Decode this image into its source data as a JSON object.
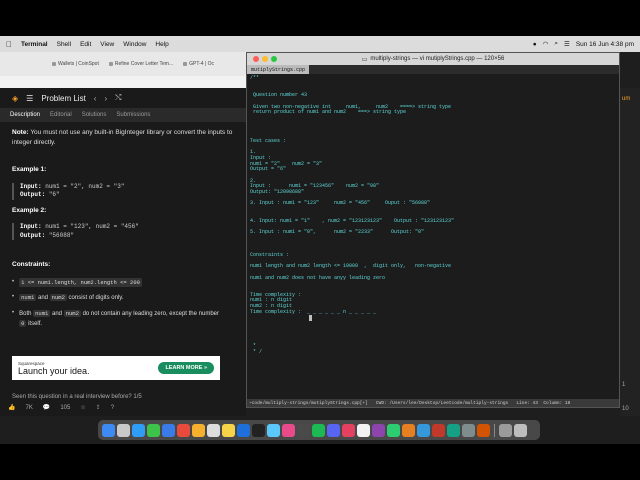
{
  "menubar": {
    "app": "Terminal",
    "items": [
      "Shell",
      "Edit",
      "View",
      "Window",
      "Help"
    ],
    "clock": "Sun 16 Jun  4:38 pm"
  },
  "browser": {
    "tabs": [
      "Wallets | CoinSpot",
      "Refine Cover Letter Tem...",
      "GPT-4 | Oc"
    ]
  },
  "leetcode": {
    "topbar_title": "Problem List",
    "tabs": [
      "Description",
      "Editorial",
      "Solutions",
      "Submissions"
    ],
    "note_bold": "Note:",
    "note_text": "You must not use any built-in BigInteger library or convert the inputs to integer directly.",
    "example1_title": "Example 1:",
    "example1_input_label": "Input:",
    "example1_input": "num1 = \"2\", num2 = \"3\"",
    "example1_output_label": "Output:",
    "example1_output": "\"6\"",
    "example2_title": "Example 2:",
    "example2_input_label": "Input:",
    "example2_input": "num1 = \"123\", num2 = \"456\"",
    "example2_output_label": "Output:",
    "example2_output": "\"56088\"",
    "constraints_title": "Constraints:",
    "c1_code": "1 <= num1.length, num2.length <= 200",
    "c2_code_a": "num1",
    "c2_mid": "and",
    "c2_code_b": "num2",
    "c2_end": "consist of digits only.",
    "c3_start": "Both",
    "c3_code_a": "num1",
    "c3_mid": "and",
    "c3_code_b": "num2",
    "c3_end": "do not contain any leading zero, except the number",
    "c3_code_c": "0",
    "c3_tail": "itself.",
    "ad_brand": "Squarespace",
    "ad_tagline": "Launch your idea.",
    "ad_button": "LEARN MORE  »",
    "seen_question": "Seen this question in a real interview before?    1/5",
    "likes": "7K",
    "comments": "105"
  },
  "right_strip": {
    "top_text": "um",
    "n1": "1",
    "n2": "10"
  },
  "terminal": {
    "title": "multiply-strings — vi mutiplyStrings.cpp — 120×56",
    "file_tab": "mutiplyStrings.cpp",
    "lines": [
      "/**",
      "",
      "",
      " Question number 43",
      "",
      " Given two non-negative int     num1,     num2    ====> string type",
      " return product of num1 and num2    ===> string type",
      "",
      "",
      "",
      "",
      "Test cases :",
      "",
      "1.",
      "Input :",
      "num1 = \"2\"    num2 = \"3\"",
      "Output = \"6\"",
      "",
      "2.",
      "Input :      num1 = \"123456\"    num2 = \"98\"",
      "Output: \"12098688\"",
      "",
      "3. Input : num1 = \"123\"     num2 = \"456\"     Ouput : \"56088\"",
      "",
      "",
      "4. Input: num1 = \"1\"    , num2 = \"123123123\"    Output : \"123123123\"",
      "",
      "5. Input : num1 = \"0\",      num2 = \"2233\"      Output: \"0\"",
      "",
      "",
      "",
      "Constraints :",
      "",
      "num1 length and num2 length <= 10000  ,  digit only,   non-negative",
      "",
      "num1 and num2 does not have anyy leading zero",
      "",
      "",
      "Time complexity :",
      "num1 : n digit",
      "num2 : n digit",
      "Time complexity :  _ _ _ _ _ _ n _ _ _ _ _",
      "",
      "",
      "",
      "",
      "",
      " *",
      " * /"
    ],
    "status": "~code/multiply-strings/mutiplyStrings.cpp[+]   CWD: /Users/lee/Desktop/Leetcode/multiply-strings   Line: 43  Column: 18"
  }
}
